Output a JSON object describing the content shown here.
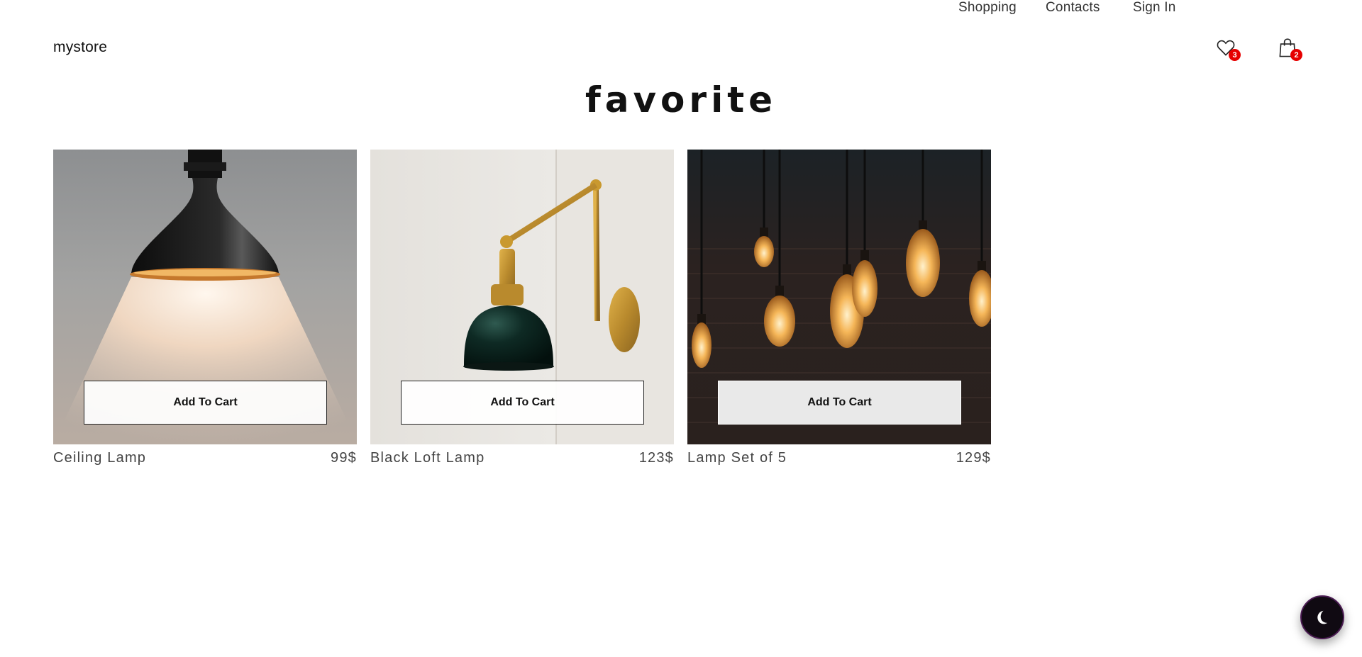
{
  "header": {
    "brand": "mystore",
    "nav": [
      "Shopping",
      "Contacts",
      "Sign In"
    ],
    "favorites_count": "3",
    "cart_count": "2",
    "favorites_icon": "heart-icon",
    "cart_icon": "shopping-bag-icon"
  },
  "page": {
    "title": "favorite"
  },
  "products": [
    {
      "name": "Ceiling Lamp",
      "price": "99$",
      "button": "Add To Cart"
    },
    {
      "name": "Black Loft Lamp",
      "price": "123$",
      "button": "Add To Cart"
    },
    {
      "name": "Lamp Set of 5",
      "price": "129$",
      "button": "Add To Cart"
    }
  ],
  "theme_toggle": {
    "icon": "moon-icon"
  },
  "colors": {
    "badge": "#e60000",
    "toggle": "#100a12"
  }
}
